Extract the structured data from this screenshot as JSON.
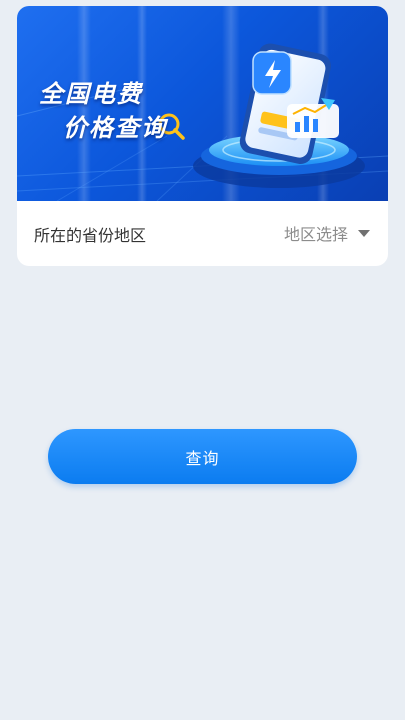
{
  "banner": {
    "line1": "全国电费",
    "line2": "价格查询"
  },
  "region": {
    "label": "所在的省份地区",
    "select_text": "地区选择",
    "caret_icon": "caret-down-icon"
  },
  "actions": {
    "query_label": "查询"
  },
  "colors": {
    "page_background": "#e9eef4",
    "banner_blue": "#0c57db",
    "button_blue": "#1b8bfa",
    "placeholder_gray": "#8c8c8c"
  }
}
